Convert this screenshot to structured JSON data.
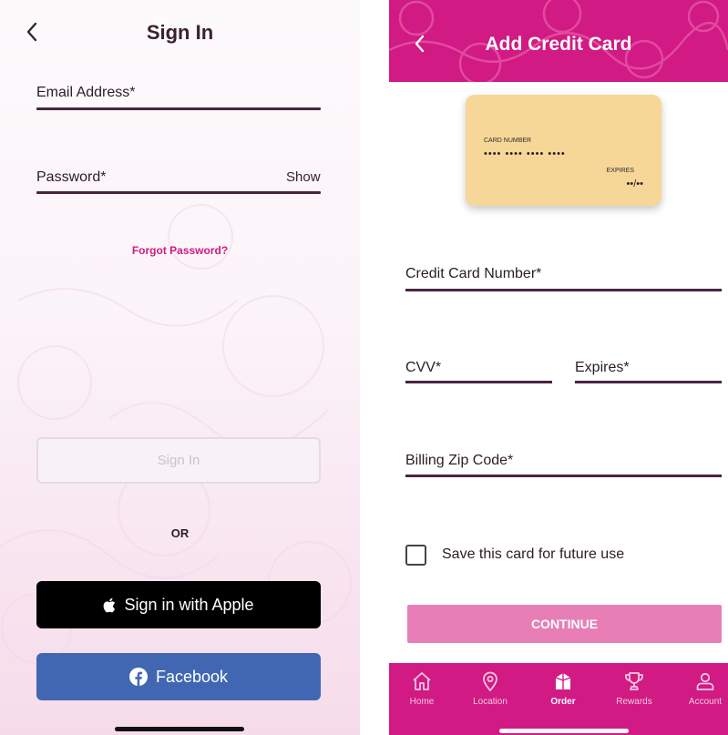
{
  "colors": {
    "brand_pink": "#d11a84",
    "continue_pink": "#e77fb6",
    "link_pink": "#cc1d82",
    "facebook_blue": "#4267b2",
    "card_gold": "#f6d798"
  },
  "sign_in": {
    "back_icon": "chevron-left-icon",
    "title": "Sign In",
    "email_label": "Email Address*",
    "password_label": "Password*",
    "show_label": "Show",
    "forgot_label": "Forgot Password?",
    "sign_in_button": "Sign In",
    "or_label": "OR",
    "apple_button": "Sign in with Apple",
    "apple_icon": "apple-logo-icon",
    "facebook_button": "Facebook",
    "facebook_icon": "facebook-logo-icon"
  },
  "add_card": {
    "back_icon": "chevron-left-icon",
    "title": "Add Credit Card",
    "card_preview": {
      "number_label": "CARD NUMBER",
      "number_mask": "•••• •••• •••• ••••",
      "expires_label": "EXPIRES",
      "expires_mask": "••/••"
    },
    "card_number_label": "Credit Card Number*",
    "cvv_label": "CVV*",
    "expires_label": "Expires*",
    "zip_label": "Billing Zip Code*",
    "save_card_label": "Save this card for future use",
    "save_card_checked": false,
    "continue_button": "CONTINUE"
  },
  "tabbar": {
    "items": [
      {
        "label": "Home",
        "icon": "home-icon",
        "active": false
      },
      {
        "label": "Location",
        "icon": "location-pin-icon",
        "active": false
      },
      {
        "label": "Order",
        "icon": "order-bag-icon",
        "active": true
      },
      {
        "label": "Rewards",
        "icon": "trophy-icon",
        "active": false
      },
      {
        "label": "Account",
        "icon": "person-icon",
        "active": false
      }
    ]
  }
}
